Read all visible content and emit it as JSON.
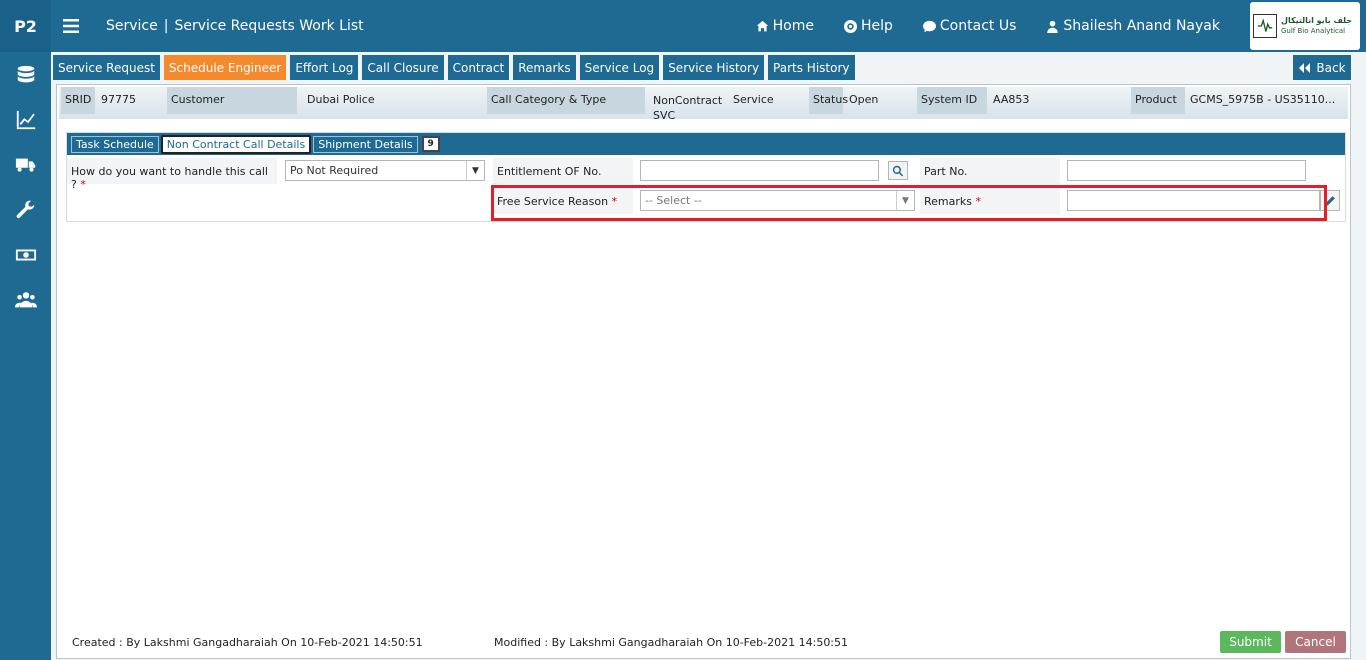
{
  "brand": {
    "short": "P2"
  },
  "header": {
    "module": "Service",
    "separator": "|",
    "page": "Service Requests Work List",
    "links": {
      "home": "Home",
      "help": "Help",
      "contact": "Contact Us",
      "user": "Shailesh Anand Nayak"
    },
    "logo": {
      "arabic": "جلف بايو انالتيكال",
      "english": "Gulf Bio Analytical"
    }
  },
  "sidebar": {
    "items": [
      "database-icon",
      "chart-line-icon",
      "truck-icon",
      "wrench-icon",
      "money-icon",
      "users-icon"
    ]
  },
  "tabs": [
    "Service Request",
    "Schedule Engineer",
    "Effort Log",
    "Call Closure",
    "Contract",
    "Remarks",
    "Service Log",
    "Service History",
    "Parts History"
  ],
  "active_tab": "Schedule Engineer",
  "back_label": "Back",
  "info": {
    "srid_label": "SRID",
    "srid": "97775",
    "customer_label": "Customer",
    "customer": "Dubai Police",
    "category_label": "Call Category & Type",
    "category": "NonContract SVC",
    "type": "Service",
    "status_label": "Status",
    "status": "Open",
    "system_label": "System ID",
    "system": "AA853",
    "product_label": "Product",
    "product": "GCMS_5975B - US35110..."
  },
  "subtabs": [
    "Task Schedule",
    "Non Contract Call Details",
    "Shipment Details"
  ],
  "calendar_badge": "9",
  "form": {
    "handle_label": "How do you want to handle this call ?",
    "handle_value": "Po Not Required",
    "entitlement_label": "Entitlement OF No.",
    "entitlement_value": "",
    "part_label": "Part No.",
    "part_value": "",
    "reason_label": "Free Service Reason",
    "reason_placeholder": "-- Select --",
    "remarks_label": "Remarks",
    "remarks_value": "",
    "required_mark": "*"
  },
  "footer": {
    "created": "Created : By Lakshmi Gangadharaiah On 10-Feb-2021 14:50:51",
    "modified": "Modified : By Lakshmi Gangadharaiah On 10-Feb-2021 14:50:51",
    "submit": "Submit",
    "cancel": "Cancel"
  },
  "colors": {
    "primary": "#1e6a92",
    "active_tab": "#f58a2c",
    "submit": "#5cb85c",
    "cancel": "#b0757a",
    "highlight": "#e41e26"
  }
}
